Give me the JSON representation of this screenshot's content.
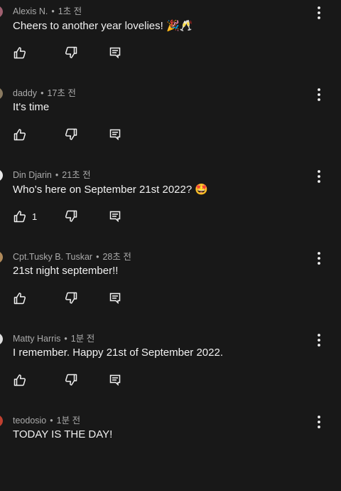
{
  "comments": [
    {
      "author": "Alexis N.",
      "separator": "•",
      "time": "1초 전",
      "text": "Cheers to another year lovelies! 🎉🥂",
      "likes": "",
      "avatar_color": "#a06070"
    },
    {
      "author": "daddy",
      "separator": "•",
      "time": "17초 전",
      "text": "It's time",
      "likes": "",
      "avatar_color": "#8a7a60"
    },
    {
      "author": "Din Djarin",
      "separator": "•",
      "time": "21초 전",
      "text": "Who's here on September 21st 2022? 🤩",
      "likes": "1",
      "avatar_color": "#e8e8e8"
    },
    {
      "author": "Cpt.Tusky B. Tuskar",
      "separator": "•",
      "time": "28초 전",
      "text": "21st night september!!",
      "likes": "",
      "avatar_color": "#b08a5a"
    },
    {
      "author": "Matty Harris",
      "separator": "•",
      "time": "1분 전",
      "text": "I remember. Happy 21st of September 2022.",
      "likes": "",
      "avatar_color": "#dddddd"
    },
    {
      "author": "teodosio",
      "separator": "•",
      "time": "1분 전",
      "text": "TODAY IS THE DAY!",
      "likes": "",
      "avatar_color": "#c04030"
    }
  ],
  "icons": {
    "like": "thumbs-up-icon",
    "dislike": "thumbs-down-icon",
    "reply": "reply-icon",
    "more": "more-vertical-icon"
  },
  "colors": {
    "background": "#181818",
    "text": "#f1f1f1",
    "meta": "#aaaaaa"
  }
}
